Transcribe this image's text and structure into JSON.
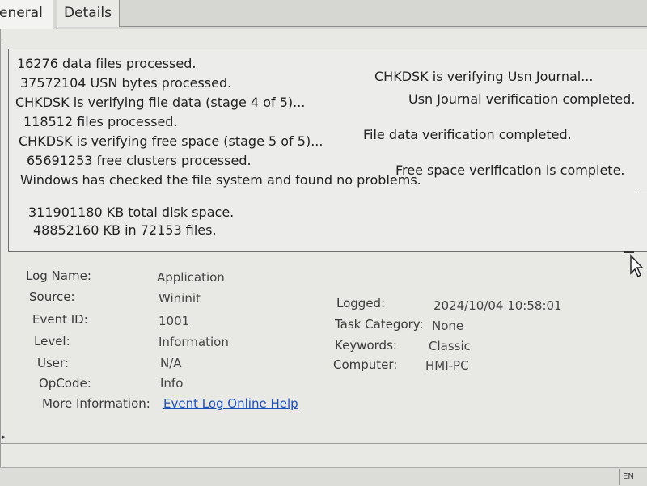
{
  "tabs": [
    {
      "label": "eneral"
    },
    {
      "label": "Details"
    }
  ],
  "description": {
    "lines": [
      "16276 data files processed.",
      "CHKDSK is verifying Usn Journal...",
      "37572104 USN bytes processed.",
      "Usn Journal verification completed.",
      "CHKDSK is verifying file data (stage 4 of 5)...",
      "118512 files processed.",
      "File data verification completed.",
      "CHKDSK is verifying free space (stage 5 of 5)...",
      "65691253 free clusters processed.",
      "Free space verification is complete.",
      "Windows has checked the file system and found no problems.",
      "311901180 KB total disk space.",
      "48852160 KB in 72153 files."
    ]
  },
  "fields": {
    "log_name": {
      "label": "Log Name:",
      "value": "Application"
    },
    "source": {
      "label": "Source:",
      "value": "Wininit"
    },
    "event_id": {
      "label": "Event ID:",
      "value": "1001"
    },
    "level": {
      "label": "Level:",
      "value": "Information"
    },
    "user": {
      "label": "User:",
      "value": "N/A"
    },
    "opcode": {
      "label": "OpCode:",
      "value": "Info"
    },
    "more_info": {
      "label": "More Information:",
      "link": "Event Log Online Help"
    },
    "logged": {
      "label": "Logged:",
      "value": "2024/10/04 10:58:01"
    },
    "task_category": {
      "label": "Task Category:",
      "value": "None"
    },
    "keywords": {
      "label": "Keywords:",
      "value": "Classic"
    },
    "computer": {
      "label": "Computer:",
      "value": "HMI-PC"
    }
  },
  "taskbar": {
    "lang": "EN"
  }
}
